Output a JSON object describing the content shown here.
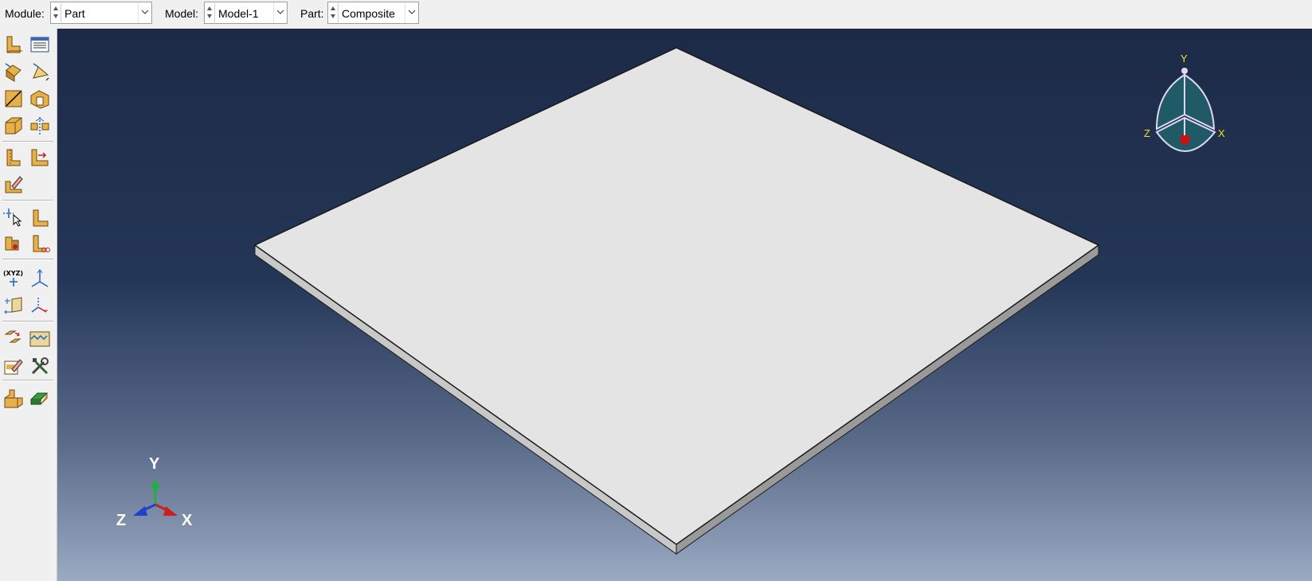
{
  "context_bar": {
    "module": {
      "label": "Module:",
      "value": "Part"
    },
    "model": {
      "label": "Model:",
      "value": "Model-1"
    },
    "part": {
      "label": "Part:",
      "value": "Composite"
    }
  },
  "toolbox": {
    "icons": [
      "create-part-icon",
      "part-manager-icon",
      "solid-extrude-icon",
      "shell-extrude-icon",
      "wire-icon",
      "cut-extrude-icon",
      "chamfer-icon",
      "mirror-icon",
      "partition-cell-icon",
      "partition-face-icon",
      "edit-feature-icon",
      "create-datum-point-icon",
      "datum-axis-icon",
      "datum-plane-icon",
      "datum-csys-icon",
      "repair-icon",
      "virtual-topology-icon",
      "sketch-icon",
      "tools-icon",
      "assembly-icon",
      "mesh-part-icon"
    ]
  },
  "viewport": {
    "triad": {
      "x": "X",
      "y": "Y",
      "z": "Z"
    },
    "view_cube": {
      "x": "X",
      "y": "Y",
      "z": "Z"
    }
  },
  "colors": {
    "bg_top": "#1c2a47",
    "bg_bottom": "#9aaac2",
    "part_face": "#e4e4e4",
    "part_edge": "#1a1a1a",
    "triad_x": "#cc2020",
    "triad_y": "#20b040",
    "triad_z": "#2040cc",
    "view_cube_fill": "#1f5a66",
    "view_cube_edge": "#e0d8f0",
    "view_cube_label": "#f0e020"
  }
}
